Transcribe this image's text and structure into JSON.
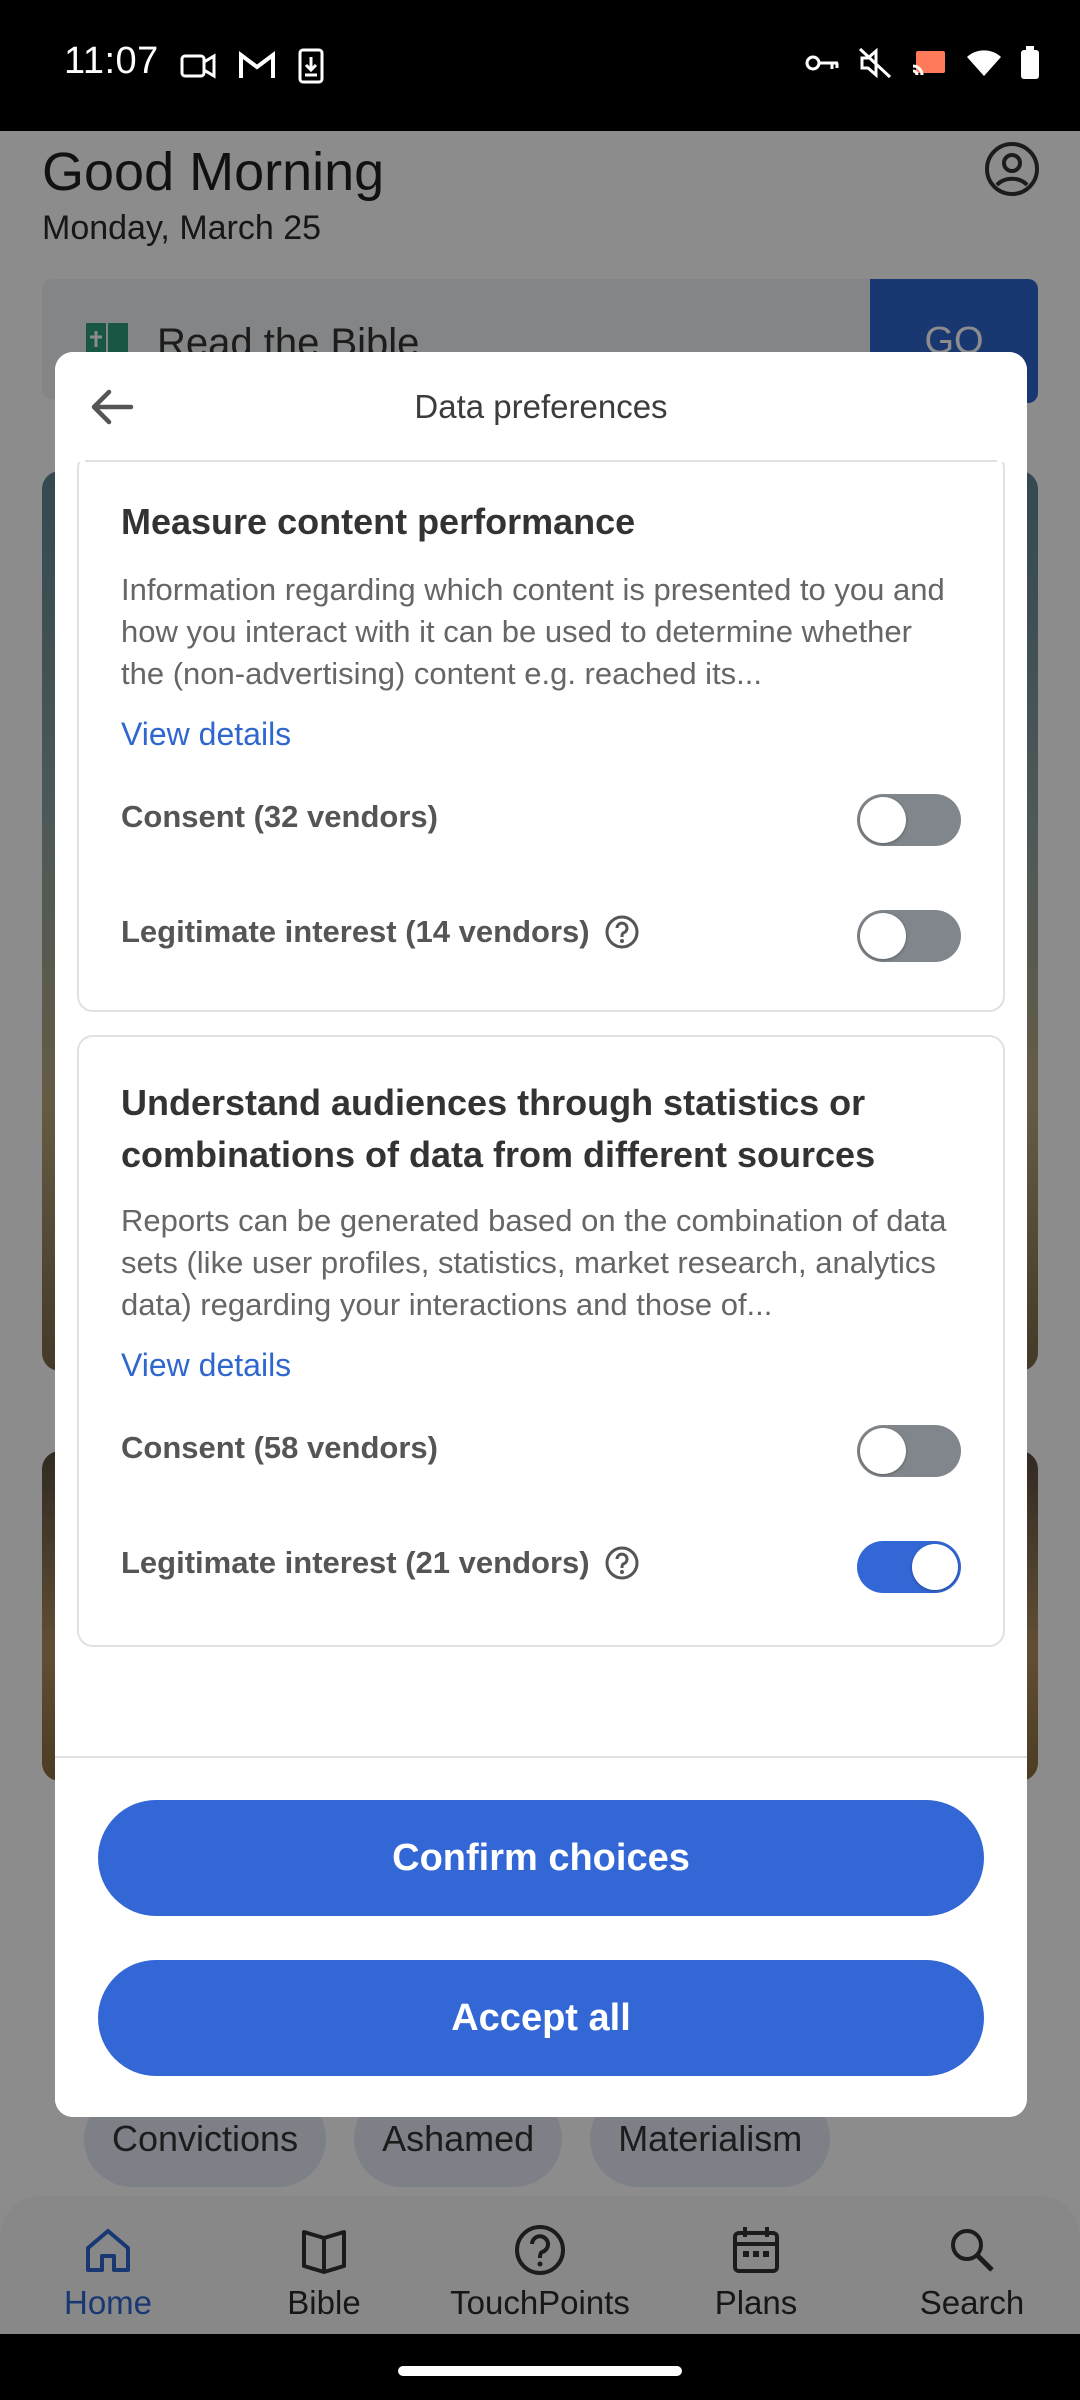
{
  "status_bar": {
    "time": "11:07"
  },
  "app": {
    "greeting": "Good Morning",
    "date": "Monday, March 25",
    "bible_card": {
      "label": "Read the Bible",
      "go": "GO"
    },
    "chips": [
      "Convictions",
      "Ashamed",
      "Materialism"
    ],
    "nav": [
      {
        "label": "Home",
        "icon": "home-icon",
        "active": true
      },
      {
        "label": "Bible",
        "icon": "bible-icon",
        "active": false
      },
      {
        "label": "TouchPoints",
        "icon": "question-icon",
        "active": false
      },
      {
        "label": "Plans",
        "icon": "calendar-icon",
        "active": false
      },
      {
        "label": "Search",
        "icon": "search-icon",
        "active": false
      }
    ]
  },
  "dialog": {
    "title": "Data preferences",
    "purposes": [
      {
        "title": "Measure content performance",
        "description": "Information regarding which content is presented to you and how you interact with it can be used to determine whether the (non-advertising) content e.g. reached its...",
        "view_details": "View details",
        "consent_label": "Consent (32 vendors)",
        "consent_on": false,
        "legit_label": "Legitimate interest (14 vendors)",
        "legit_on": false
      },
      {
        "title": "Understand audiences through statistics or combinations of data from different sources",
        "description": "Reports can be generated based on the combination of data sets (like user profiles, statistics, market research, analytics data) regarding your interactions and those of...",
        "view_details": "View details",
        "consent_label": "Consent (58 vendors)",
        "consent_on": false,
        "legit_label": "Legitimate interest (21 vendors)",
        "legit_on": true
      }
    ],
    "confirm_label": "Confirm choices",
    "accept_label": "Accept all"
  },
  "colors": {
    "accent": "#3367d6",
    "toggle_off": "#80868b"
  }
}
